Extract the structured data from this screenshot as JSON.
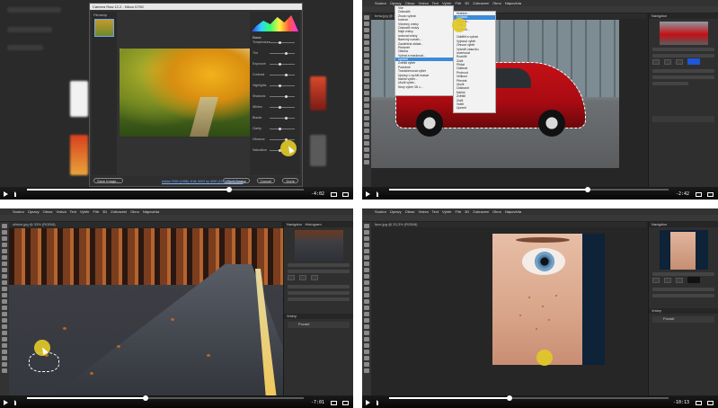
{
  "panel1": {
    "dialog_title": "Camera Raw 12.2  -  Nikon D750",
    "left_tab": "Filmstrip",
    "right_header": "Basic",
    "slider_labels": [
      "Temperature",
      "Tint",
      "Exposure",
      "Contrast",
      "Highlights",
      "Shadows",
      "Whites",
      "Blacks",
      "Clarity",
      "Vibrance",
      "Saturation"
    ],
    "bottom_left": "Save Image...",
    "bottom_center": "Adobe RGB (1998); 8 bit; 6000 by 4000 (24.0MP); 300 ppi",
    "open_button": "Open Image",
    "cancel_button": "Cancel",
    "done_button": "Done",
    "time": "-4:02"
  },
  "panel2": {
    "menubar": [
      "Soubor",
      "Úpravy",
      "Obraz",
      "Vrstva",
      "Text",
      "Výběr",
      "Filtr",
      "3D",
      "Zobrazení",
      "Okno",
      "Nápověda"
    ],
    "tab": "bmw.jpg @ 33,3% (RGB/8)",
    "menu1": [
      "Vše",
      "Odznačit",
      "Znovu vybrat",
      "Inverze",
      "Všechny vrstvy",
      "Odznačit vrstvy",
      "Najít vrstvy",
      "Izolovat vrstvy",
      "Barevný rozsah...",
      "Zaostřená oblast...",
      "Předmět",
      "Obloha",
      "Vybrat a maskovat...",
      "Upravit",
      "Zvětšit výběr",
      "Podobné",
      "Transformovat výběr",
      "Úpravy v rychlé masce",
      "Načíst výběr...",
      "Uložit výběr...",
      "Nový výběr 3D z..."
    ],
    "menu1_highlight": 13,
    "menu2": [
      "Hranice...",
      "Vyhladit...",
      "Rozšířit...",
      "Zúžit...",
      "Prolnutí...",
      "",
      "Oddělit a vybrat",
      "Vyjmout výběr",
      "Ohnout výběr",
      "Vytvořit zásuvku",
      "Invertovat",
      "Rozšířit",
      "Zúžit",
      "Přidat",
      "Odebrat",
      "Protnout",
      "Velikost",
      "Převést",
      "Uložit",
      "Odstranit",
      "Načíst",
      "Zvětšit",
      "Zúžit",
      "Vrátit",
      "Upravit"
    ],
    "menu2_highlight": 1,
    "navigator": "Navigátor",
    "time": "-2:42"
  },
  "panel3": {
    "menubar": [
      "Soubor",
      "Úpravy",
      "Obraz",
      "Vrstva",
      "Text",
      "Výběr",
      "Filtr",
      "3D",
      "Zobrazení",
      "Okno",
      "Nápověda"
    ],
    "tab": "silnice.jpg @ 33% (RGB/8)",
    "navigator": "Navigátor",
    "histogram": "Histogram",
    "layers": "Vrstvy",
    "layer_name": "Pozadí",
    "time": "-7:01"
  },
  "panel4": {
    "menubar": [
      "Soubor",
      "Úpravy",
      "Obraz",
      "Vrstva",
      "Text",
      "Výběr",
      "Filtr",
      "3D",
      "Zobrazení",
      "Okno",
      "Nápověda"
    ],
    "tab": "face.jpg @ 33,3% (RGB/8)",
    "navigator": "Navigátor",
    "layers": "Vrstvy",
    "layer_name": "Pozadí",
    "time": "-10:13"
  },
  "colors": {
    "selection_blue": "#3a8bd9",
    "cursor_yellow": "#e1c828",
    "ps_dark": "#262626"
  },
  "video_progress": [
    0.73,
    0.71,
    0.43,
    0.43
  ]
}
